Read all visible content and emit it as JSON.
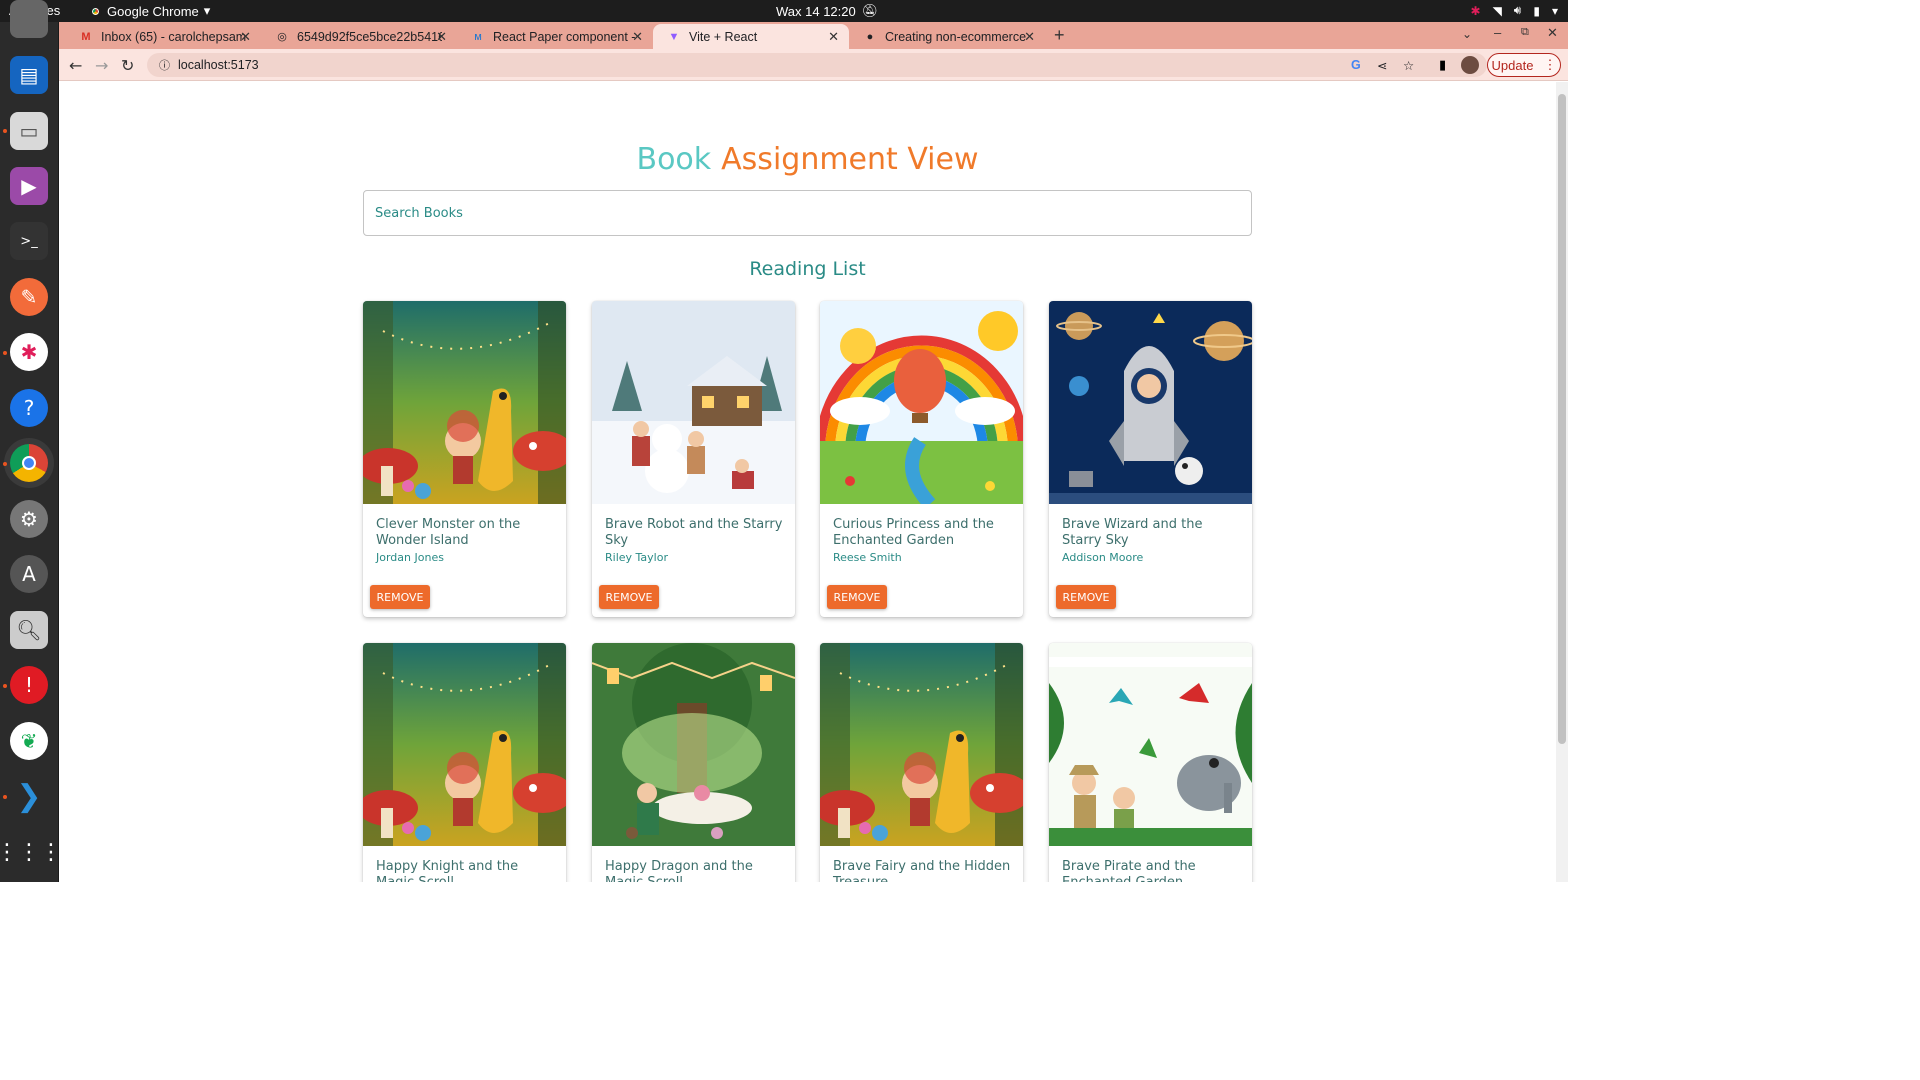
{
  "system_bar": {
    "activities": "Activities",
    "app_name": "Google Chrome",
    "clock": "Wax 14  12:20"
  },
  "browser": {
    "tabs": [
      {
        "label": "Inbox (65) - carolchepsam",
        "icon": "gmail-icon"
      },
      {
        "label": "6549d92f5ce5bce22b5416",
        "icon": "globe-icon"
      },
      {
        "label": "React Paper component -",
        "icon": "mui-icon"
      },
      {
        "label": "Vite + React",
        "icon": "vite-icon"
      },
      {
        "label": "Creating non-ecommerce",
        "icon": "github-icon"
      }
    ],
    "url": "localhost:5173",
    "update_label": "Update"
  },
  "page": {
    "title_part1": "Book",
    "title_part2": "Assignment View",
    "search_placeholder": "Search Books",
    "section_title": "Reading List",
    "remove_label": "REMOVE",
    "books": [
      {
        "title": "Clever Monster on the Wonder Island",
        "author": "Jordan Jones",
        "cover": "forest-dragon"
      },
      {
        "title": "Brave Robot and the Starry Sky",
        "author": "Riley Taylor",
        "cover": "snow-village"
      },
      {
        "title": "Curious Princess and the Enchanted Garden",
        "author": "Reese Smith",
        "cover": "rainbow-balloon"
      },
      {
        "title": "Brave Wizard and the Starry Sky",
        "author": "Addison Moore",
        "cover": "space-rocket"
      },
      {
        "title": "Happy Knight and the Magic Scroll",
        "author": "",
        "cover": "forest-dragon"
      },
      {
        "title": "Happy Dragon and the Magic Scroll",
        "author": "",
        "cover": "tea-party"
      },
      {
        "title": "Brave Fairy and the Hidden Treasure",
        "author": "",
        "cover": "forest-dragon"
      },
      {
        "title": "Brave Pirate and the Enchanted Garden",
        "author": "",
        "cover": "jungle-explorers"
      }
    ]
  }
}
